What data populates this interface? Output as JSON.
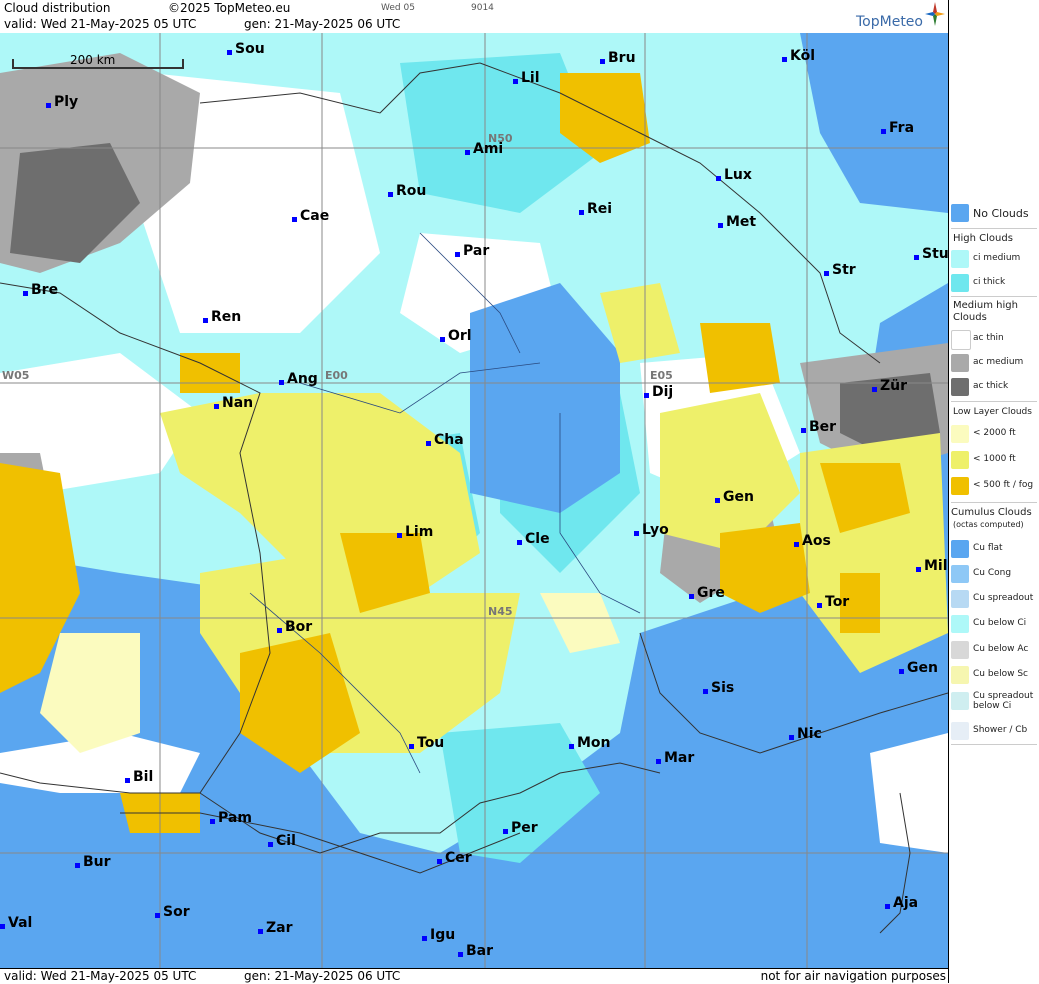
{
  "header": {
    "title": "Cloud distribution",
    "copyright": "©2025 TopMeteo.eu",
    "valid": "valid:  Wed  21-May-2025  05 UTC",
    "gen": "gen: 21-May-2025 06 UTC",
    "small_day": "Wed 05",
    "small_code": "9014",
    "brand": "TopMeteo"
  },
  "footer": {
    "valid": "valid:  Wed  21-May-2025  05 UTC",
    "gen": "gen: 21-May-2025 06 UTC",
    "disclaimer": "not for air navigation purposes"
  },
  "scale": {
    "label": "200 km"
  },
  "grid_labels": {
    "n50": "N50",
    "n45": "N45",
    "w05": "W05",
    "e00": "E00",
    "e05": "E05"
  },
  "cities": [
    {
      "name": "Sou"
    },
    {
      "name": "Ply"
    },
    {
      "name": "Lil"
    },
    {
      "name": "Bru"
    },
    {
      "name": "Köl"
    },
    {
      "name": "Fra"
    },
    {
      "name": "Ami"
    },
    {
      "name": "Rou"
    },
    {
      "name": "Cae"
    },
    {
      "name": "Lux"
    },
    {
      "name": "Rei"
    },
    {
      "name": "Met"
    },
    {
      "name": "Par"
    },
    {
      "name": "Bre"
    },
    {
      "name": "Ren"
    },
    {
      "name": "Str"
    },
    {
      "name": "Stu"
    },
    {
      "name": "Orl"
    },
    {
      "name": "Ang"
    },
    {
      "name": "Nan"
    },
    {
      "name": "Dij"
    },
    {
      "name": "Zür"
    },
    {
      "name": "Ber"
    },
    {
      "name": "Cha"
    },
    {
      "name": "Gen"
    },
    {
      "name": "Lim"
    },
    {
      "name": "Cle"
    },
    {
      "name": "Lyo"
    },
    {
      "name": "Aos"
    },
    {
      "name": "Mil"
    },
    {
      "name": "Gre"
    },
    {
      "name": "Tor"
    },
    {
      "name": "Bor"
    },
    {
      "name": "Gen"
    },
    {
      "name": "Sis"
    },
    {
      "name": "Tou"
    },
    {
      "name": "Mon"
    },
    {
      "name": "Nic"
    },
    {
      "name": "Mar"
    },
    {
      "name": "Bil"
    },
    {
      "name": "Pam"
    },
    {
      "name": "Per"
    },
    {
      "name": "Cil"
    },
    {
      "name": "Cer"
    },
    {
      "name": "Bur"
    },
    {
      "name": "Sor"
    },
    {
      "name": "Val"
    },
    {
      "name": "Zar"
    },
    {
      "name": "Igu"
    },
    {
      "name": "Bar"
    },
    {
      "name": "Aja"
    }
  ],
  "legend": {
    "no_clouds": {
      "label": "No Clouds",
      "color": "#5aa6f0"
    },
    "high_title": "High Clouds",
    "high": [
      {
        "label": "ci medium",
        "color": "#aef8f8"
      },
      {
        "label": "ci thick",
        "color": "#6fe7ee"
      }
    ],
    "medium_title": "Medium high Clouds",
    "medium": [
      {
        "label": "ac thin",
        "color": "#ffffff"
      },
      {
        "label": "ac medium",
        "color": "#a9a9a9"
      },
      {
        "label": "ac thick",
        "color": "#6e6e6e"
      }
    ],
    "low_title": "Low Layer Clouds",
    "low": [
      {
        "label": "< 2000 ft",
        "color": "#fbfbbf"
      },
      {
        "label": "< 1000 ft",
        "color": "#eef06a"
      },
      {
        "label": "< 500 ft / fog",
        "color": "#f0c000"
      }
    ],
    "cumulus_title": "Cumulus Clouds",
    "cumulus_sub": "(octas computed)",
    "cumulus": [
      {
        "label": "Cu flat",
        "color": "#5aa6f0"
      },
      {
        "label": "Cu Cong",
        "color": "#8ec8f6"
      },
      {
        "label": "Cu spreadout",
        "color": "#b7d9f3"
      },
      {
        "label": "Cu below Ci",
        "color": "#aef8f8"
      },
      {
        "label": "Cu below Ac",
        "color": "#d8d8d8"
      },
      {
        "label": "Cu below Sc",
        "color": "#f6f6b0"
      },
      {
        "label": "Cu spreadout below Ci",
        "color": "#cfeef0"
      },
      {
        "label": "Shower / Cb",
        "color": "#e6eef6"
      }
    ]
  }
}
